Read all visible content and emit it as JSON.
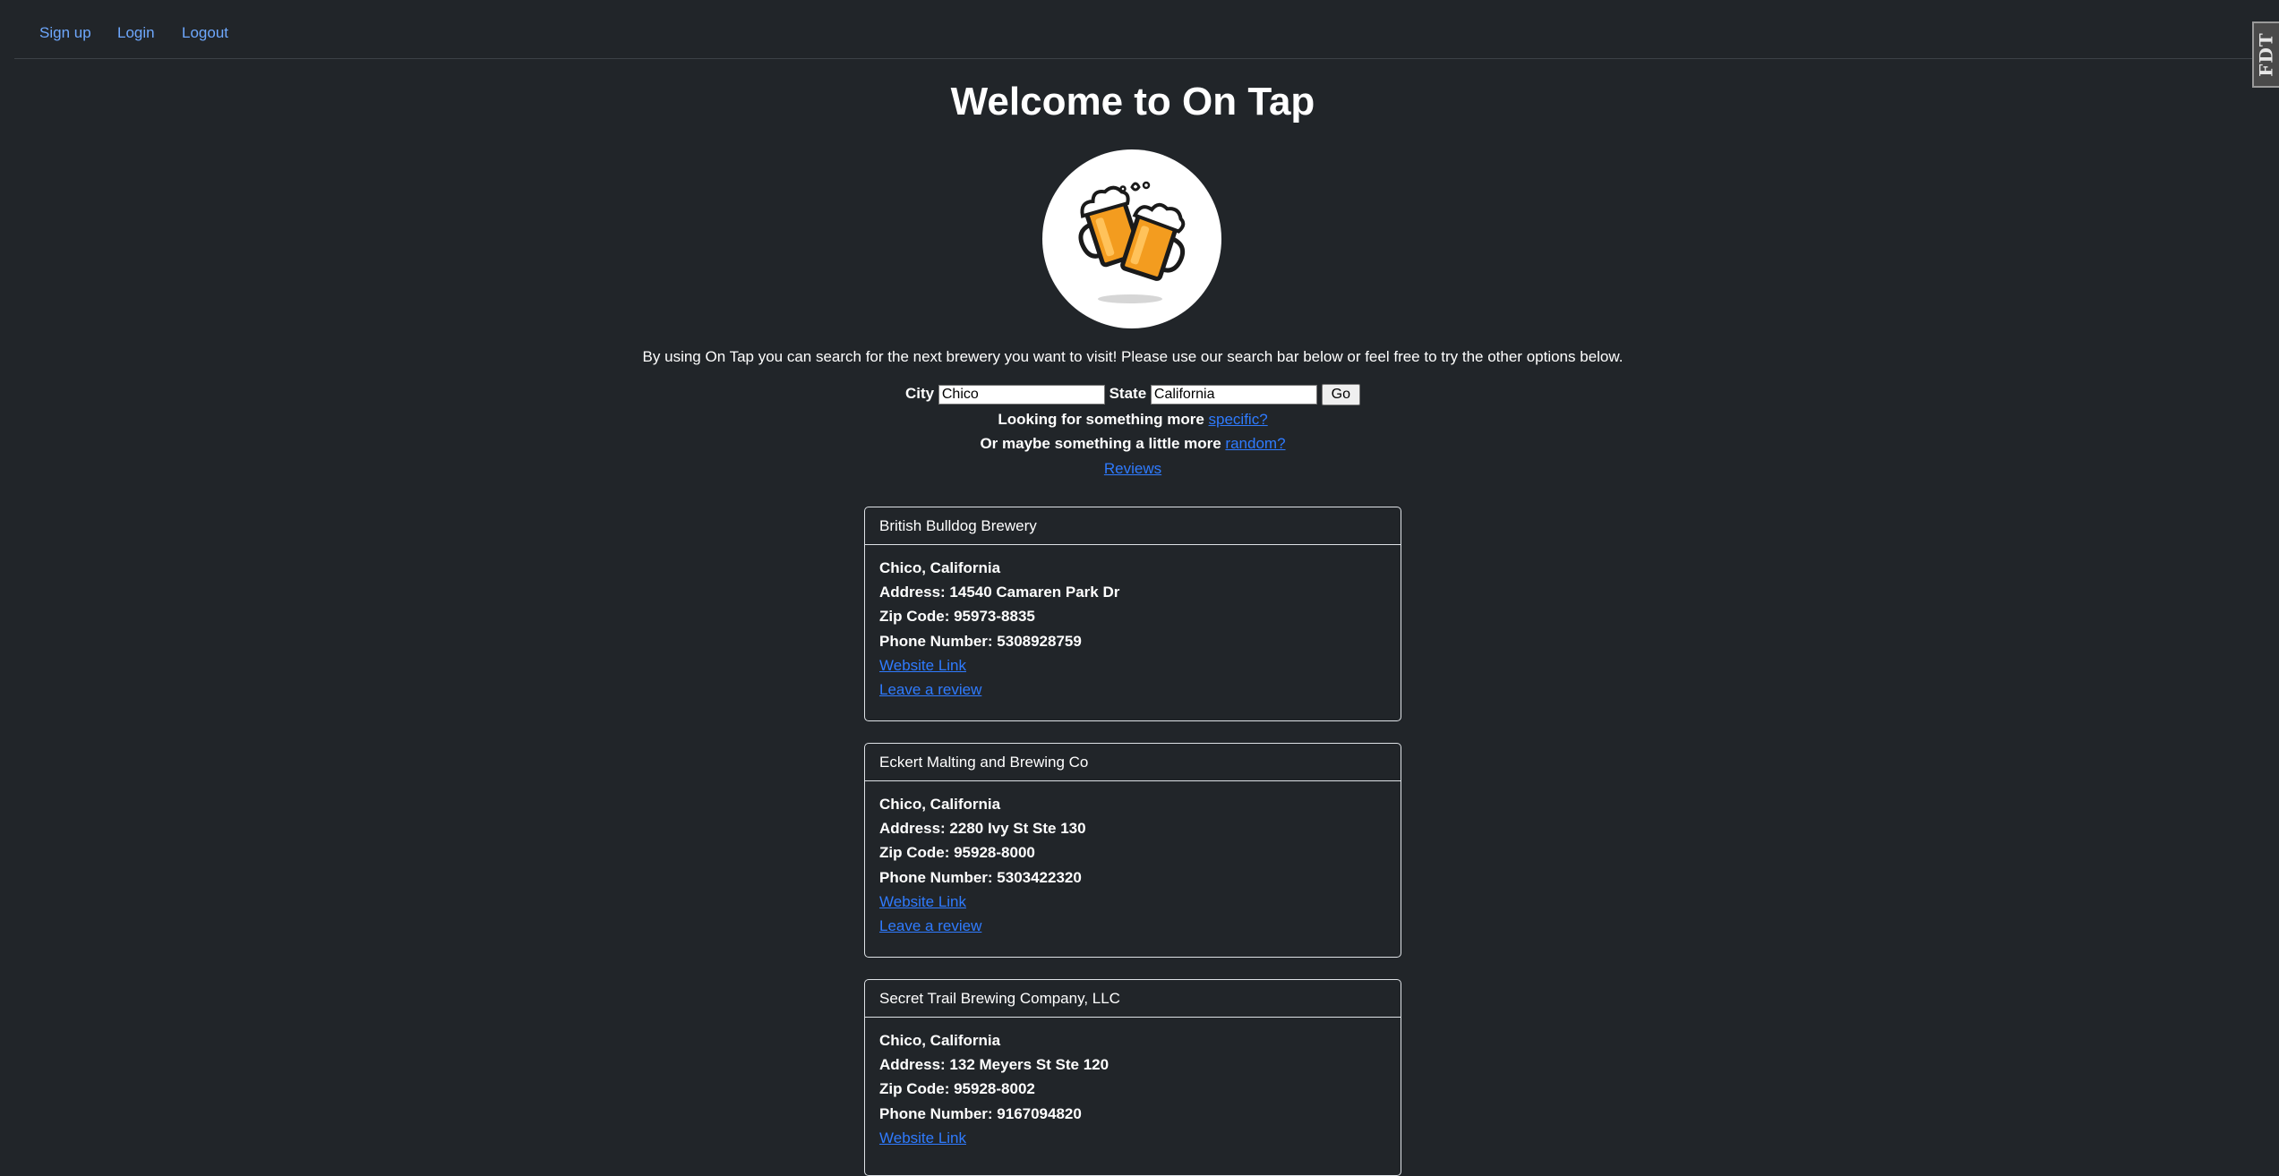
{
  "nav": {
    "items": [
      {
        "label": "Sign up"
      },
      {
        "label": "Login"
      },
      {
        "label": "Logout"
      }
    ]
  },
  "extension_tab": {
    "label": "FDT"
  },
  "page_title": "Welcome to On Tap",
  "logo": {
    "icon": "beer-mugs-cheers-icon"
  },
  "intro": "By using On Tap you can search for the next brewery you want to visit! Please use our search bar below or feel free to try the other options below.",
  "search": {
    "city_label": "City",
    "city_value": "Chico",
    "state_label": "State",
    "state_value": "California",
    "go_label": "Go"
  },
  "specific_line": {
    "text": "Looking for something more ",
    "link": "specific?"
  },
  "random_line": {
    "text": "Or maybe something a little more ",
    "link": "random?"
  },
  "reviews_link": "Reviews",
  "breweries": [
    {
      "name": "British Bulldog Brewery",
      "location": "Chico, California",
      "address": "Address: 14540 Camaren Park Dr",
      "zip": "Zip Code: 95973-8835",
      "phone": "Phone Number: 5308928759",
      "website_link": "Website Link",
      "review_link": "Leave a review"
    },
    {
      "name": "Eckert Malting and Brewing Co",
      "location": "Chico, California",
      "address": "Address: 2280 Ivy St Ste 130",
      "zip": "Zip Code: 95928-8000",
      "phone": "Phone Number: 5303422320",
      "website_link": "Website Link",
      "review_link": "Leave a review"
    },
    {
      "name": "Secret Trail Brewing Company, LLC",
      "location": "Chico, California",
      "address": "Address: 132 Meyers St Ste 120",
      "zip": "Zip Code: 95928-8002",
      "phone": "Phone Number: 9167094820",
      "website_link": "Website Link"
    }
  ],
  "colors": {
    "background": "#212529",
    "link": "#2f7bff",
    "nav_link": "#6ea8fe",
    "beer": "#f39c1f"
  }
}
